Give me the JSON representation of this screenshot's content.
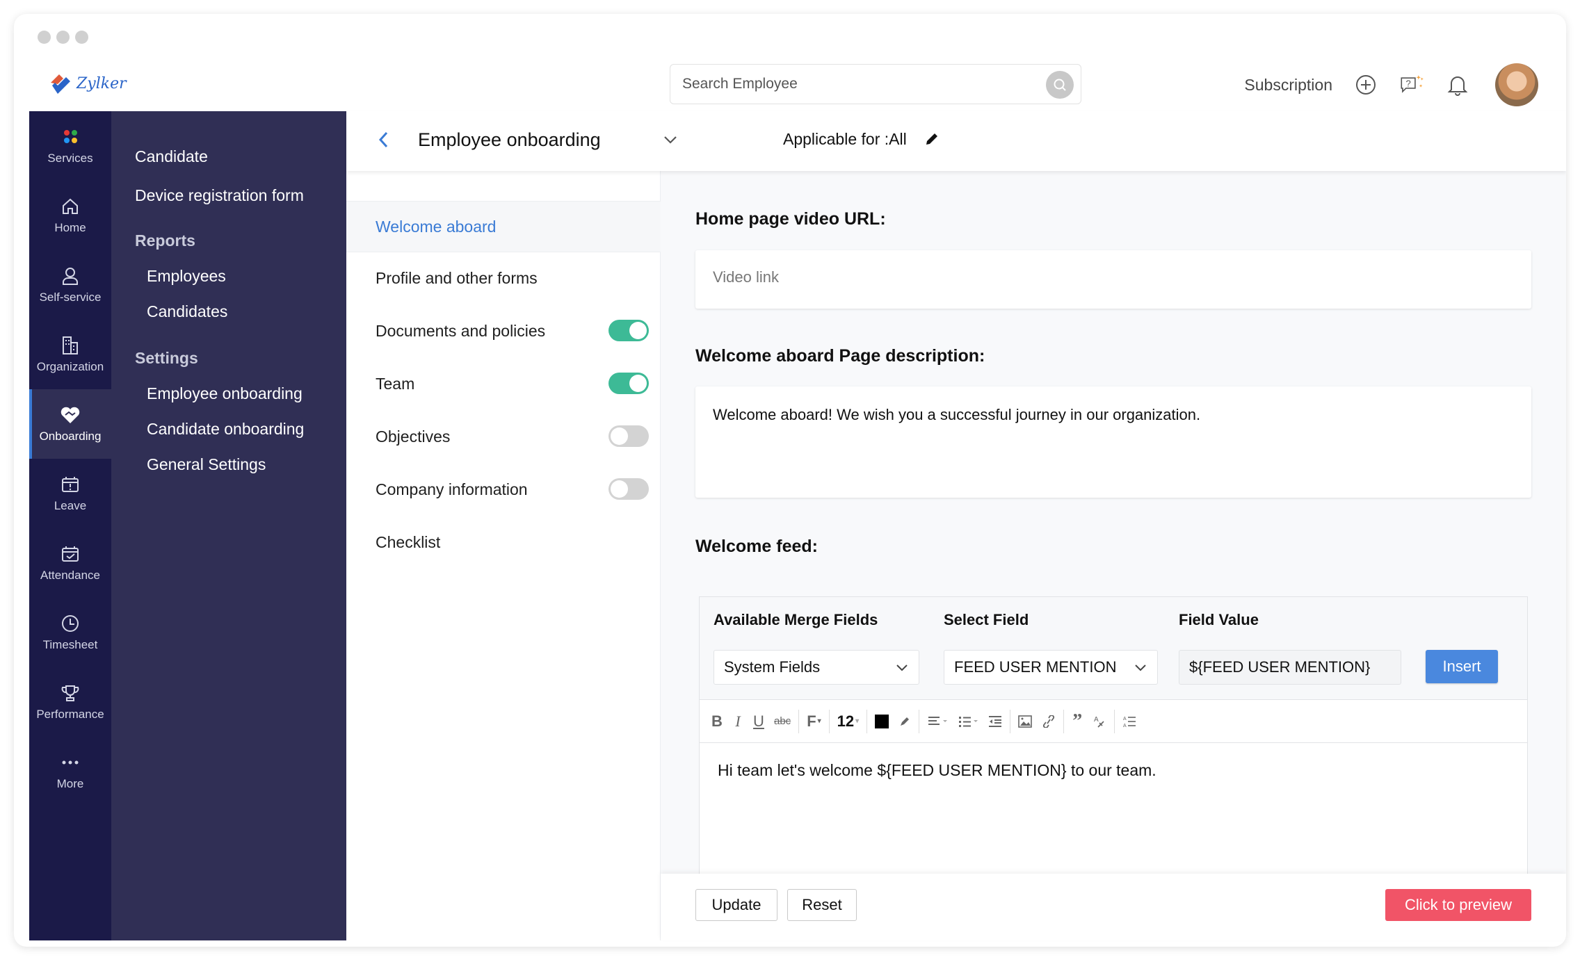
{
  "app": {
    "brand": "Zylker"
  },
  "header": {
    "search_placeholder": "Search Employee",
    "subscription_label": "Subscription",
    "icons": [
      "search-icon",
      "add-circle-icon",
      "help-chat-icon",
      "bell-icon",
      "avatar"
    ]
  },
  "rail": {
    "items": [
      {
        "label": "Services",
        "icon": "services-dots-icon"
      },
      {
        "label": "Home",
        "icon": "home-icon"
      },
      {
        "label": "Self-service",
        "icon": "person-icon"
      },
      {
        "label": "Organization",
        "icon": "building-icon"
      },
      {
        "label": "Onboarding",
        "icon": "handshake-icon",
        "active": true
      },
      {
        "label": "Leave",
        "icon": "calendar-alert-icon"
      },
      {
        "label": "Attendance",
        "icon": "calendar-check-icon"
      },
      {
        "label": "Timesheet",
        "icon": "clock-icon"
      },
      {
        "label": "Performance",
        "icon": "trophy-icon"
      },
      {
        "label": "More",
        "icon": "more-dots-icon"
      }
    ]
  },
  "submenu": {
    "candidate": "Candidate",
    "device_form": "Device registration form",
    "reports_header": "Reports",
    "reports": [
      "Employees",
      "Candidates"
    ],
    "settings_header": "Settings",
    "settings": [
      "Employee onboarding",
      "Candidate onboarding",
      "General Settings"
    ]
  },
  "topbar": {
    "title": "Employee onboarding",
    "applicable": "Applicable for :All"
  },
  "steps": [
    {
      "label": "Welcome aboard",
      "active": true
    },
    {
      "label": "Profile and other forms"
    },
    {
      "label": "Documents and policies",
      "toggle": true
    },
    {
      "label": "Team",
      "toggle": true
    },
    {
      "label": "Objectives",
      "toggle": false
    },
    {
      "label": "Company information",
      "toggle": false
    },
    {
      "label": "Checklist"
    }
  ],
  "form": {
    "video_label": "Home page video URL:",
    "video_placeholder": "Video link",
    "description_label": "Welcome aboard Page description:",
    "description_value": "Welcome aboard! We wish you a successful journey in our organization.",
    "feed_label": "Welcome feed:",
    "merge": {
      "available_label": "Available Merge Fields",
      "available_value": "System Fields",
      "select_label": "Select Field",
      "select_value": "FEED USER MENTION",
      "value_label": "Field Value",
      "value_value": "${FEED USER MENTION}",
      "insert_label": "Insert"
    },
    "toolbar": {
      "font_size": "12",
      "bold": "B",
      "italic": "I",
      "underline": "U",
      "strike": "abc",
      "font": "F",
      "text_color": "#000000"
    },
    "feed_text": "Hi team let's welcome ${FEED USER MENTION} to our team."
  },
  "footer": {
    "update": "Update",
    "reset": "Reset",
    "preview": "Click to preview"
  },
  "colors": {
    "rail_bg": "#1b1a48",
    "submenu_bg": "#302f55",
    "accent": "#3a7bd5",
    "toggle_on": "#3dba96",
    "insert": "#4a88de",
    "preview": "#f15467"
  }
}
